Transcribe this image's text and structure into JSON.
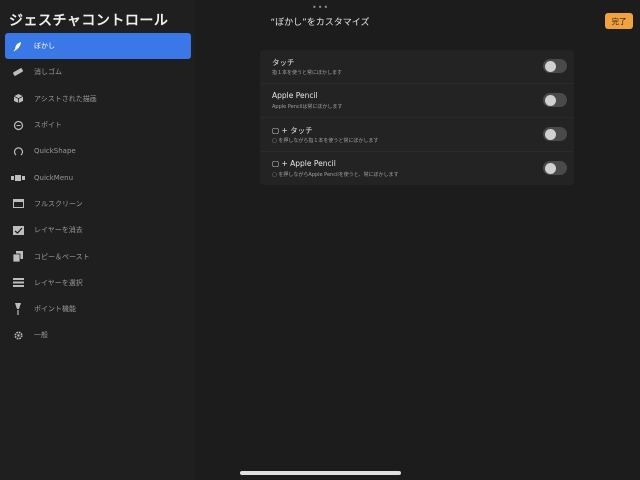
{
  "sidebar": {
    "title": "ジェスチャコントロール",
    "items": [
      {
        "label": "ぼかし",
        "icon": "smudge-icon",
        "active": true
      },
      {
        "label": "消しゴム",
        "icon": "eraser-icon",
        "active": false
      },
      {
        "label": "アシストされた描画",
        "icon": "cube-icon",
        "active": false
      },
      {
        "label": "スポイト",
        "icon": "eyedropper-icon",
        "active": false
      },
      {
        "label": "QuickShape",
        "icon": "quickshape-icon",
        "active": false
      },
      {
        "label": "QuickMenu",
        "icon": "quickmenu-icon",
        "active": false
      },
      {
        "label": "フルスクリーン",
        "icon": "fullscreen-icon",
        "active": false
      },
      {
        "label": "レイヤーを消去",
        "icon": "clear-layer-icon",
        "active": false
      },
      {
        "label": "コピー＆ペースト",
        "icon": "copy-paste-icon",
        "active": false
      },
      {
        "label": "レイヤーを選択",
        "icon": "layer-select-icon",
        "active": false
      },
      {
        "label": "ポイント機能",
        "icon": "pointer-icon",
        "active": false
      },
      {
        "label": "一般",
        "icon": "gear-icon",
        "active": false
      }
    ]
  },
  "header": {
    "dots": "•••",
    "title": "“ぼかし”をカスタマイズ",
    "done_label": "完了"
  },
  "options": [
    {
      "title": "タッチ",
      "subtitle": "指１本を使うと常にぼかします",
      "enabled": false
    },
    {
      "title": "Apple Pencil",
      "subtitle": "Apple Pencilは常にぼかします",
      "enabled": false
    },
    {
      "title": "▢ + タッチ",
      "subtitle": "▢ を押しながら指１本を使うと常にぼかします",
      "enabled": false
    },
    {
      "title": "▢ + Apple Pencil",
      "subtitle": "▢ を押しながらApple Pencilを使うと、常にぼかします",
      "enabled": false
    }
  ],
  "colors": {
    "accent": "#3b78e7",
    "done_button": "#f0a23c",
    "background": "#1c1c1c"
  }
}
